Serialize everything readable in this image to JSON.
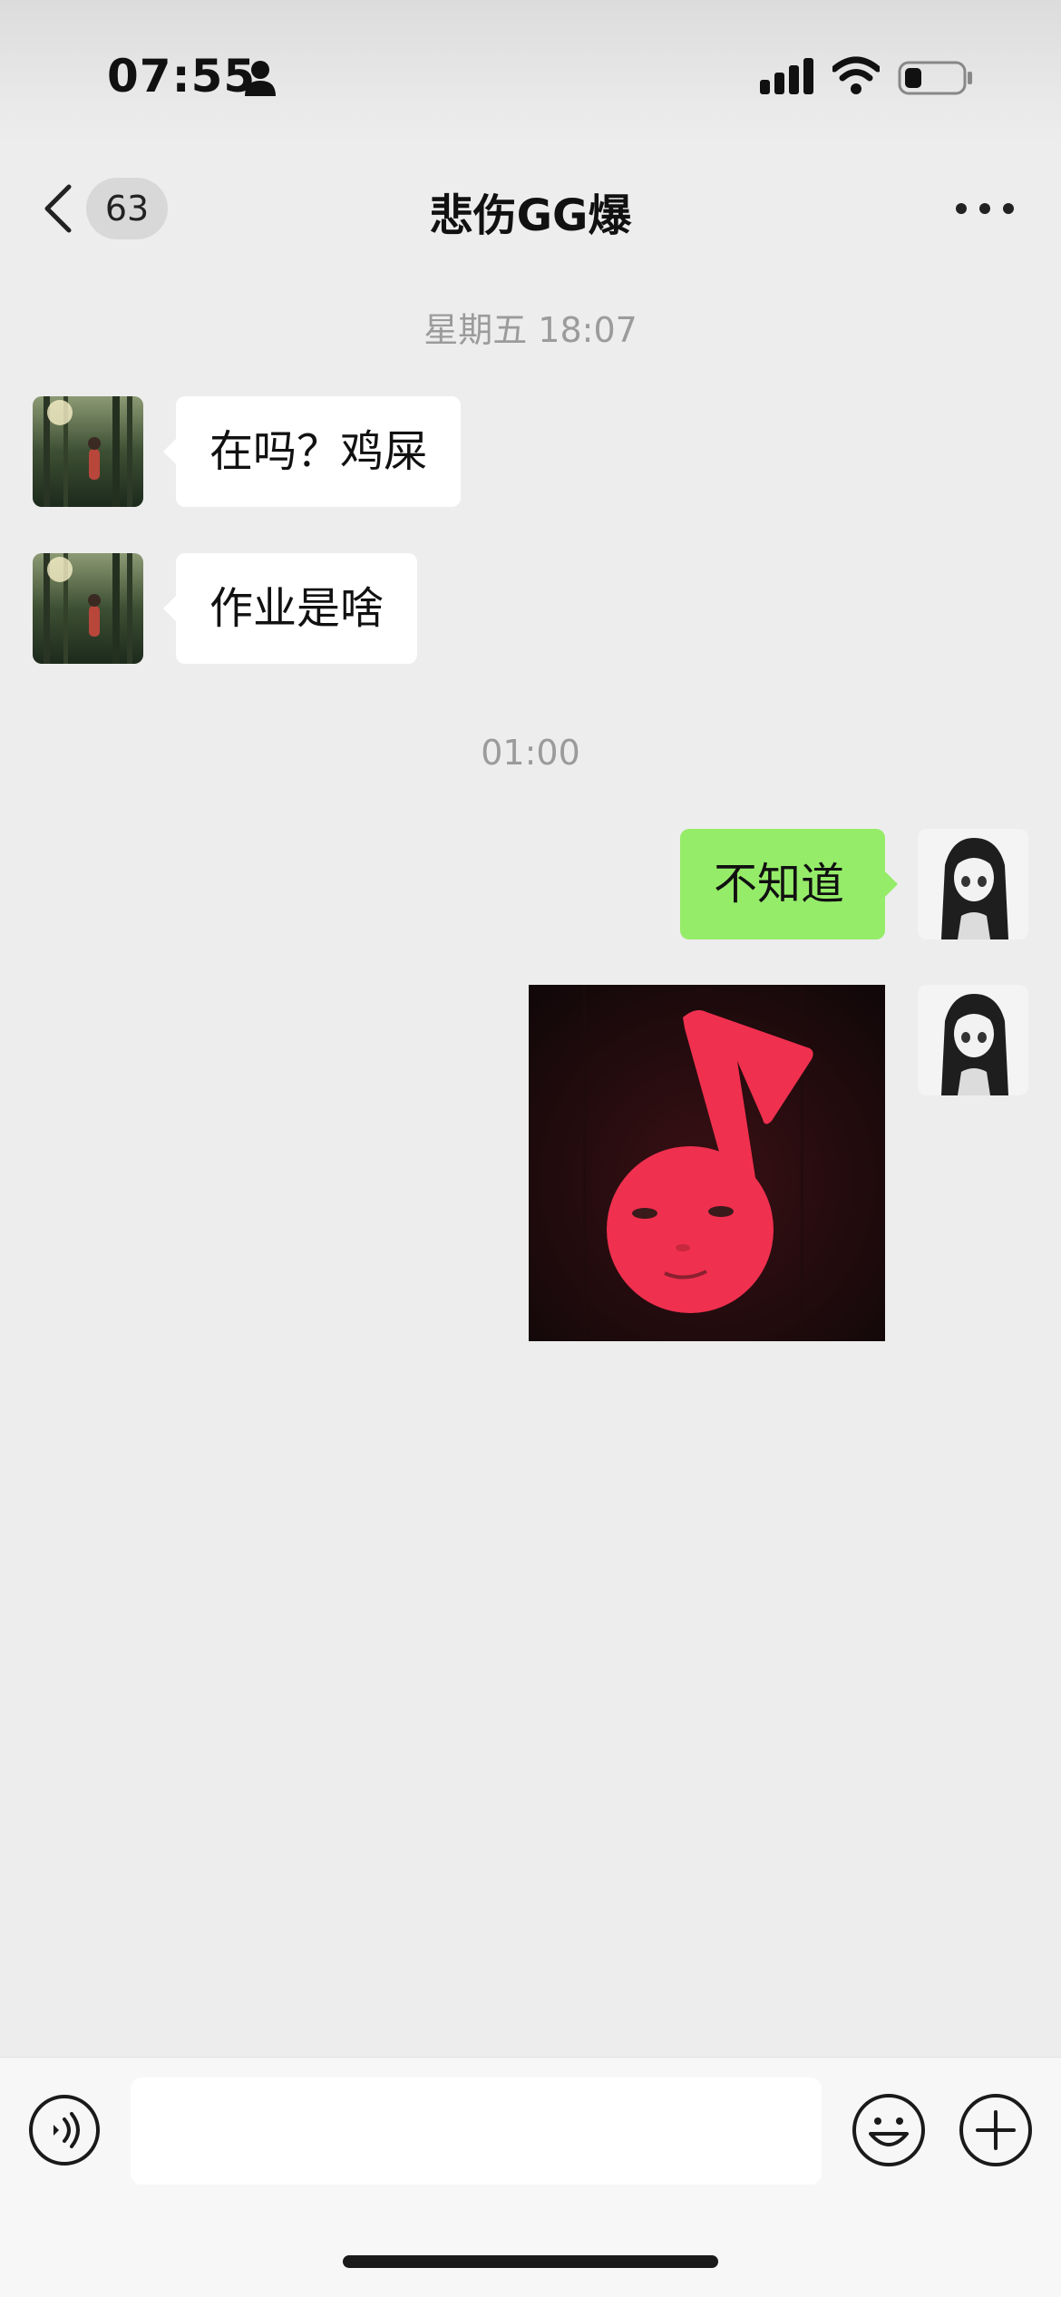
{
  "status_bar": {
    "time": "07:55",
    "icons": [
      "person-icon",
      "signal-icon",
      "wifi-icon",
      "battery-icon"
    ]
  },
  "nav": {
    "back_icon": "chevron-left-icon",
    "unread_count": "63",
    "title": "悲伤GG爆",
    "more_icon": "more-dots-icon"
  },
  "messages": [
    {
      "type": "timestamp",
      "text": "星期五 18:07"
    },
    {
      "type": "text",
      "direction": "incoming",
      "text": "在吗？鸡屎"
    },
    {
      "type": "text",
      "direction": "incoming",
      "text": "作业是啥"
    },
    {
      "type": "timestamp",
      "text": "01:00"
    },
    {
      "type": "text",
      "direction": "outgoing",
      "text": "不知道"
    },
    {
      "type": "sticker",
      "direction": "outgoing",
      "description_icon": "music-note-face-sticker"
    }
  ],
  "input_bar": {
    "voice_icon": "voice-icon",
    "input_value": "",
    "emoji_icon": "emoji-icon",
    "plus_icon": "plus-icon"
  },
  "colors": {
    "background": "#ededed",
    "outgoing_bubble": "#95ec69",
    "incoming_bubble": "#ffffff",
    "sticker_red": "#f0304f"
  }
}
